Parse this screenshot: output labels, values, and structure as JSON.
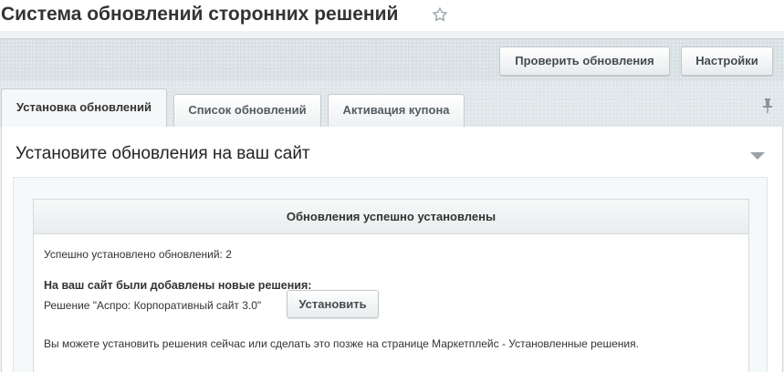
{
  "page": {
    "title": "Система обновлений сторонних решений",
    "favorite_icon": "star-icon"
  },
  "toolbar": {
    "check_updates_label": "Проверить обновления",
    "settings_label": "Настройки"
  },
  "tabs": [
    {
      "label": "Установка обновлений",
      "active": true
    },
    {
      "label": "Список обновлений",
      "active": false
    },
    {
      "label": "Активация купона",
      "active": false
    }
  ],
  "tabs_pin_icon": "pin-icon",
  "panel": {
    "title": "Установите обновления на ваш сайт",
    "collapse_icon": "chevron-down-icon"
  },
  "notice": {
    "header": "Обновления успешно установлены",
    "installed_count_text": "Успешно установлено обновлений: 2",
    "new_solutions_heading": "На ваш сайт были добавлены новые решения:",
    "solution_text": "Решение \"Аспро: Корпоративный сайт 3.0\"",
    "install_button_label": "Установить",
    "footer_text": "Вы можете установить решения сейчас или сделать это позже на странице Маркетплейс - Установленные решения."
  },
  "colors": {
    "background": "#eef2f4",
    "toolbar": "#d8e0e4",
    "text": "#333333",
    "button_text": "#434c50"
  }
}
